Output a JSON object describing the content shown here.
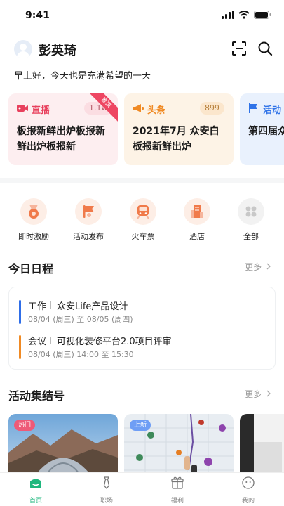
{
  "status_bar": {
    "time": "9:41"
  },
  "header": {
    "user_name": "彭英琦",
    "greeting": "早上好，今天也是充满希望的一天"
  },
  "cards": [
    {
      "tag": "直播",
      "count": "1.1w",
      "ribbon": "置顶",
      "title": "板报新鲜出炉板报新鲜出炉板报新",
      "color": "#e8405d"
    },
    {
      "tag": "头条",
      "count": "899",
      "title": "2021年7月 众安白板报新鲜出炉",
      "color": "#f08a24"
    },
    {
      "tag": "活动",
      "title": "第四届众流赛 火热",
      "color": "#2f73e8"
    }
  ],
  "quick_actions": [
    {
      "label": "即时激励",
      "icon": "medal-icon"
    },
    {
      "label": "活动发布",
      "icon": "flag-icon"
    },
    {
      "label": "火车票",
      "icon": "train-icon"
    },
    {
      "label": "酒店",
      "icon": "hotel-icon"
    },
    {
      "label": "全部",
      "icon": "grid-icon"
    }
  ],
  "schedule": {
    "title": "今日日程",
    "more": "更多",
    "items": [
      {
        "type": "工作",
        "title": "众安Life产品设计",
        "time": "08/04 (周三) 至 08/05 (周四)",
        "color": "#2f6ee8"
      },
      {
        "type": "会议",
        "title": "可视化装修平台2.0项目评审",
        "time": "08/04 (周三) 14:00 至 15:30",
        "color": "#f08a24"
      }
    ]
  },
  "events": {
    "title": "活动集结号",
    "more": "更多",
    "items": [
      {
        "badge": "热门",
        "badge_color": "#ee5a78"
      },
      {
        "badge": "上新",
        "badge_color": "#6f9ef5"
      },
      {
        "badge": ""
      }
    ]
  },
  "tabbar": [
    {
      "label": "首页",
      "icon": "home-icon",
      "active": true
    },
    {
      "label": "职场",
      "icon": "tie-icon"
    },
    {
      "label": "福利",
      "icon": "gift-icon"
    },
    {
      "label": "我的",
      "icon": "profile-icon"
    }
  ],
  "colors": {
    "accent": "#1fb77e"
  }
}
